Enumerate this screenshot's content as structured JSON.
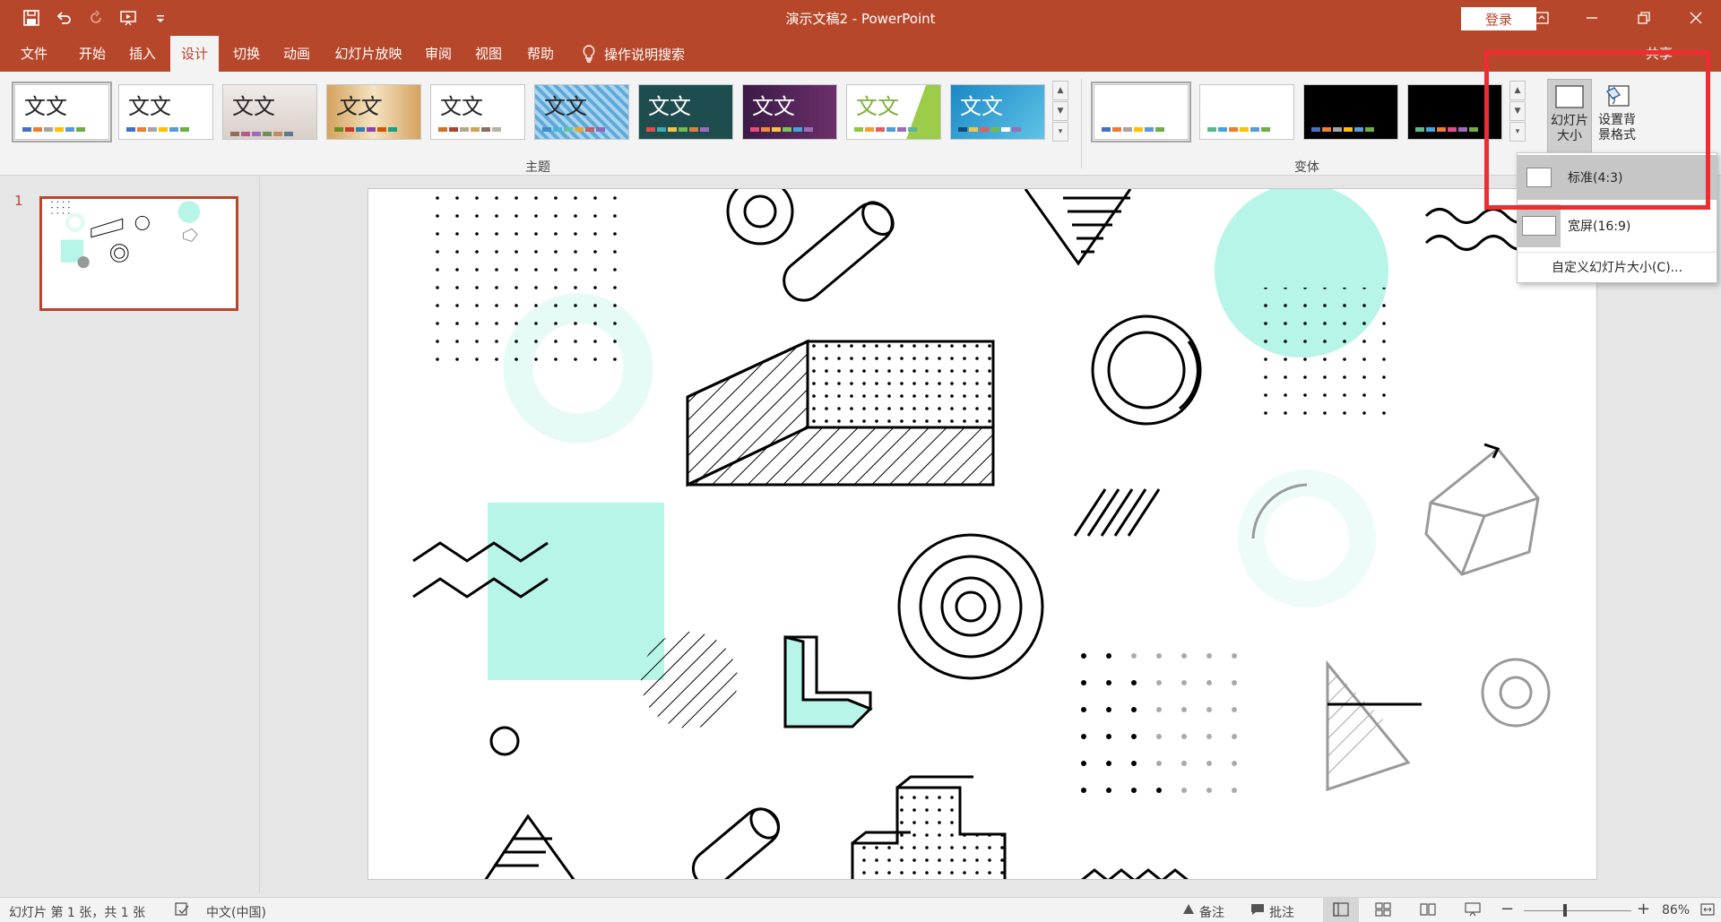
{
  "window": {
    "title": "演示文稿2  -  PowerPoint",
    "login_label": "登录"
  },
  "tabs": [
    {
      "label": "文件"
    },
    {
      "label": "开始"
    },
    {
      "label": "插入"
    },
    {
      "label": "设计",
      "active": true
    },
    {
      "label": "切换"
    },
    {
      "label": "动画"
    },
    {
      "label": "幻灯片放映"
    },
    {
      "label": "审阅"
    },
    {
      "label": "视图"
    },
    {
      "label": "帮助"
    }
  ],
  "tell_me": "操作说明搜索",
  "share": "共享",
  "ribbon": {
    "themes_label": "主题",
    "variants_label": "变体",
    "theme_text": "文文",
    "slide_size_label_1": "幻灯片",
    "slide_size_label_2": "大小",
    "format_bg_label_1": "设置背",
    "format_bg_label_2": "景格式"
  },
  "slide_size_menu": {
    "items": [
      {
        "label": "标准(4:3)"
      },
      {
        "label": "宽屏(16:9)"
      }
    ],
    "custom_label": "自定义幻灯片大小(C)..."
  },
  "thumbnails": {
    "slide_number": "1"
  },
  "status": {
    "slide_info": "幻灯片 第 1 张，共 1 张",
    "language": "中文(中国)",
    "notes_label": "备注",
    "comments_label": "批注",
    "zoom": "86%",
    "zoom_fraction": 0.86
  },
  "colors": {
    "accent": "#b7472a",
    "mint": "#b6f5e7",
    "highlight_red": "#ee2d33"
  }
}
